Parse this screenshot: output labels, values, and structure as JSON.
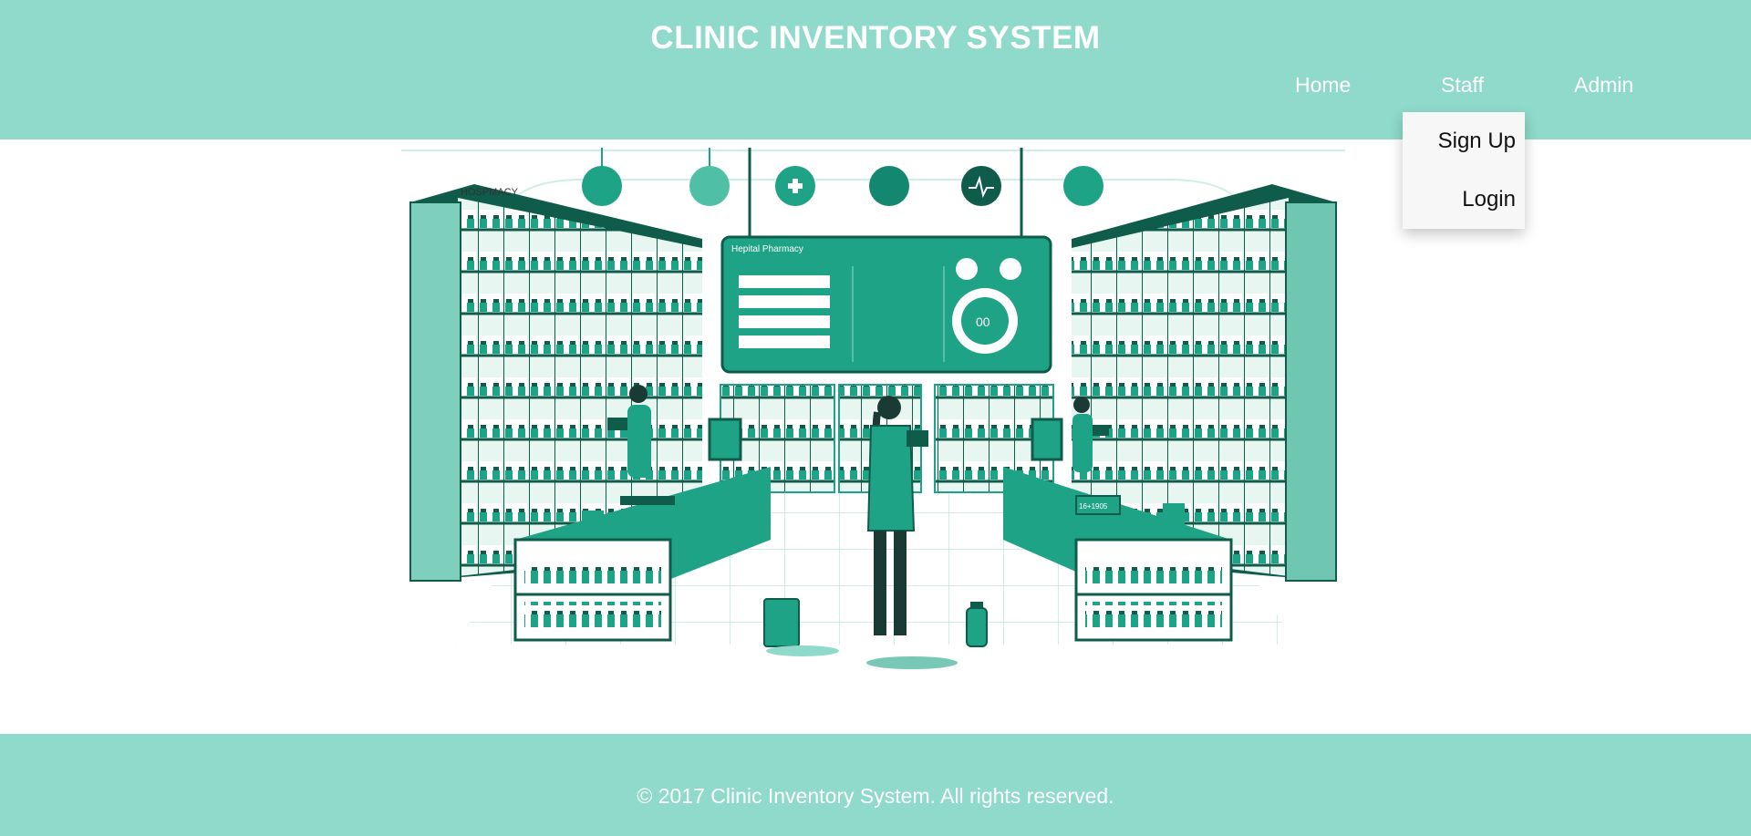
{
  "header": {
    "title": "CLINIC INVENTORY SYSTEM",
    "nav": {
      "home": "Home",
      "staff": "Staff",
      "admin": "Admin"
    },
    "staff_menu": {
      "sign_up": "Sign Up",
      "login": "Login"
    }
  },
  "hero": {
    "illustration": "pharmacy-inventory-illustration",
    "sign": "HOSPMACY",
    "screen_title": "Hepital Pharmacy",
    "dial_value": "00",
    "register_display": "16+1905"
  },
  "footer": {
    "copyright": "© 2017 Clinic Inventory System. All rights reserved."
  },
  "colors": {
    "brand": "#8fdaca",
    "accent": "#1fa386",
    "dark_accent": "#0f5c4b"
  }
}
